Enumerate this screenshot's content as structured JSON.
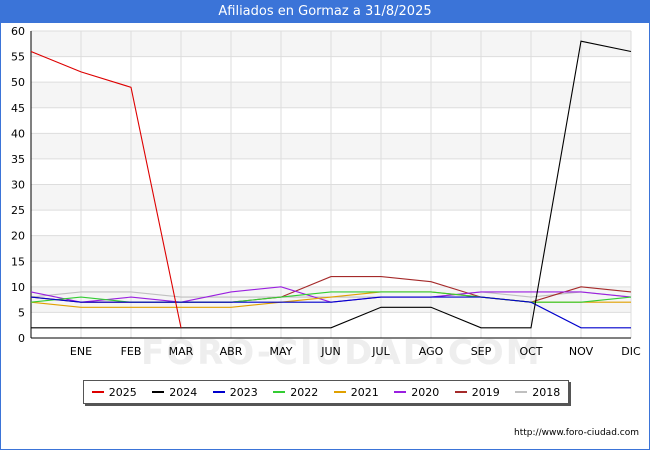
{
  "header": {
    "title": "Afiliados en Gormaz a 31/8/2025"
  },
  "footer": {
    "url": "http://www.foro-ciudad.com"
  },
  "watermark": "FORO-CIUDAD.COM",
  "chart_data": {
    "type": "line",
    "title": "Afiliados en Gormaz a 31/8/2025",
    "xlabel": "",
    "ylabel": "",
    "categories": [
      "",
      "ENE",
      "FEB",
      "MAR",
      "ABR",
      "MAY",
      "JUN",
      "JUL",
      "AGO",
      "SEP",
      "OCT",
      "NOV",
      "DIC"
    ],
    "ylim": [
      0,
      60
    ],
    "yticks": [
      0,
      5,
      10,
      15,
      20,
      25,
      30,
      35,
      40,
      45,
      50,
      55,
      60
    ],
    "grid": true,
    "legend": "bottom",
    "series": [
      {
        "name": "2018",
        "color": "#c0c0c0",
        "values": [
          8,
          9,
          9,
          8,
          8,
          8,
          8,
          8,
          8,
          9,
          8,
          9,
          8
        ]
      },
      {
        "name": "2019",
        "color": "#a52a2a",
        "values": [
          8,
          7,
          7,
          7,
          7,
          8,
          12,
          12,
          11,
          8,
          7,
          10,
          9
        ]
      },
      {
        "name": "2020",
        "color": "#9a1fe0",
        "values": [
          9,
          7,
          8,
          7,
          9,
          10,
          7,
          8,
          8,
          9,
          9,
          9,
          8
        ]
      },
      {
        "name": "2021",
        "color": "#e0a000",
        "values": [
          7,
          6,
          6,
          6,
          6,
          7,
          8,
          9,
          9,
          8,
          7,
          7,
          7
        ]
      },
      {
        "name": "2022",
        "color": "#33cc33",
        "values": [
          7,
          8,
          7,
          7,
          7,
          8,
          9,
          9,
          9,
          8,
          7,
          7,
          8
        ]
      },
      {
        "name": "2023",
        "color": "#0000cc",
        "values": [
          8,
          7,
          7,
          7,
          7,
          7,
          7,
          8,
          8,
          8,
          7,
          2,
          2
        ]
      },
      {
        "name": "2024",
        "color": "#000000",
        "values": [
          2,
          2,
          2,
          2,
          2,
          2,
          2,
          6,
          6,
          2,
          2,
          58,
          56
        ]
      },
      {
        "name": "2025",
        "color": "#dd0000",
        "values": [
          56,
          52,
          49,
          2,
          null,
          null,
          null,
          null,
          null,
          null,
          null,
          null,
          null
        ]
      }
    ],
    "legend_order": [
      "2025",
      "2024",
      "2023",
      "2022",
      "2021",
      "2020",
      "2019",
      "2018"
    ]
  }
}
